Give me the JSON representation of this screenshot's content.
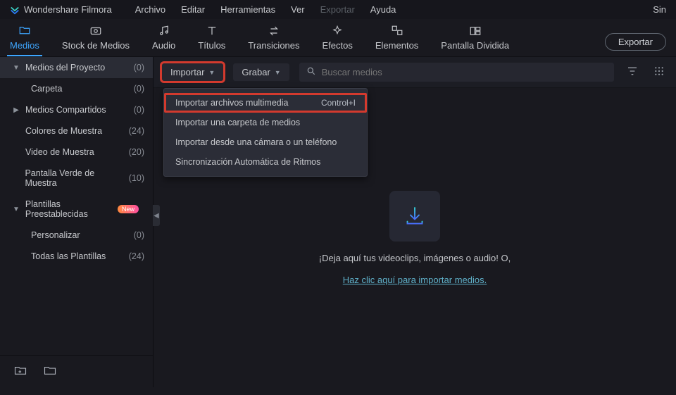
{
  "title": "Wondershare Filmora",
  "menus": [
    "Archivo",
    "Editar",
    "Herramientas",
    "Ver",
    "Exportar",
    "Ayuda"
  ],
  "disabled_menu_index": 4,
  "right_label": "Sin",
  "tools": [
    {
      "label": "Medios",
      "icon": "folder"
    },
    {
      "label": "Stock de Medios",
      "icon": "camera"
    },
    {
      "label": "Audio",
      "icon": "music"
    },
    {
      "label": "Títulos",
      "icon": "text"
    },
    {
      "label": "Transiciones",
      "icon": "swap"
    },
    {
      "label": "Efectos",
      "icon": "sparkle"
    },
    {
      "label": "Elementos",
      "icon": "shapes"
    },
    {
      "label": "Pantalla Dividida",
      "icon": "split"
    }
  ],
  "active_tool": 0,
  "export_label": "Exportar",
  "sidebar": [
    {
      "label": "Medios del Proyecto",
      "count": "(0)",
      "caret": "down",
      "selected": true
    },
    {
      "label": "Carpeta",
      "count": "(0)",
      "indent": true
    },
    {
      "label": "Medios Compartidos",
      "count": "(0)",
      "caret": "right"
    },
    {
      "label": "Colores de Muestra",
      "count": "(24)"
    },
    {
      "label": "Video de Muestra",
      "count": "(20)"
    },
    {
      "label": "Pantalla Verde de Muestra",
      "count": "(10)"
    },
    {
      "label": "Plantillas Preestablecidas",
      "count": "",
      "caret": "down",
      "badge": "New"
    },
    {
      "label": "Personalizar",
      "count": "(0)",
      "indent": true
    },
    {
      "label": "Todas las Plantillas",
      "count": "(24)",
      "indent": true
    }
  ],
  "actions": {
    "import": "Importar",
    "record": "Grabar",
    "search_placeholder": "Buscar medios"
  },
  "dropdown": [
    {
      "label": "Importar archivos multimedia",
      "shortcut": "Control+I",
      "hl": true
    },
    {
      "label": "Importar una carpeta de medios"
    },
    {
      "label": "Importar desde una cámara o un teléfono"
    },
    {
      "label": "Sincronización Automática de Ritmos"
    }
  ],
  "empty": {
    "line1": "¡Deja aquí tus videoclips, imágenes o audio! O,",
    "link": "Haz clic aquí para importar medios."
  }
}
